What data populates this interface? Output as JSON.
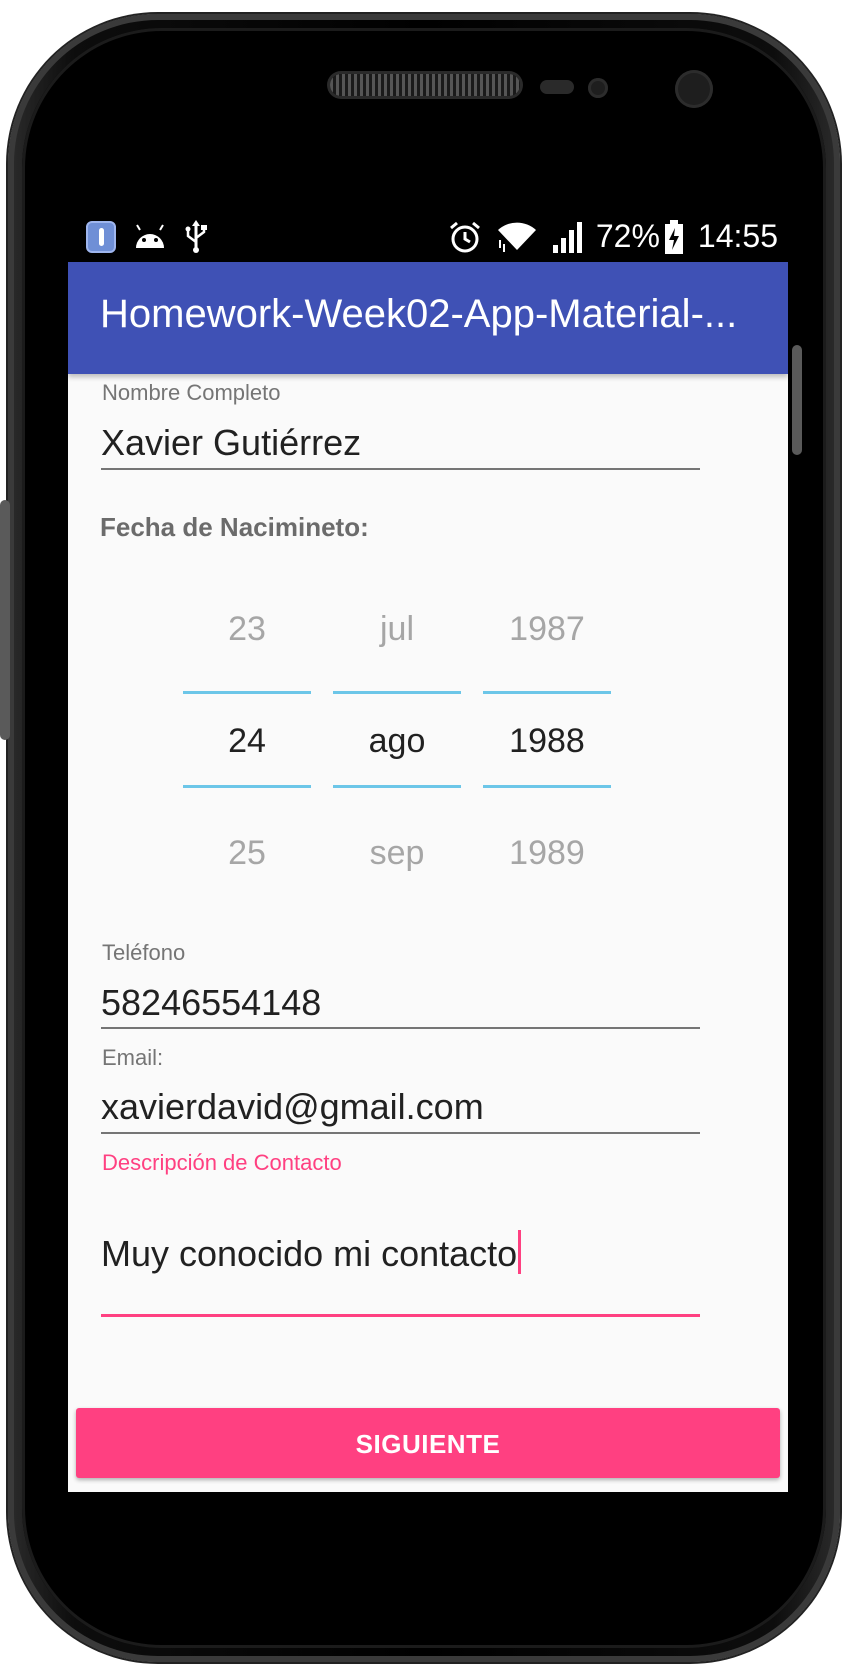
{
  "statusbar": {
    "battery": "72%",
    "time": "14:55",
    "left_icons": [
      "thermometer-app-icon",
      "android-icon",
      "usb-icon"
    ],
    "right_icons": [
      "alarm-icon",
      "wifi-icon",
      "signal-icon",
      "battery-charging-icon"
    ]
  },
  "appbar": {
    "title": "Homework-Week02-App-Material-..."
  },
  "form": {
    "name": {
      "label": "Nombre Completo",
      "value": "Xavier Gutiérrez"
    },
    "birthdate_title": "Fecha de Nacimineto:",
    "picker": {
      "day": {
        "prev": "23",
        "current": "24",
        "next": "25"
      },
      "month": {
        "prev": "jul",
        "current": "ago",
        "next": "sep"
      },
      "year": {
        "prev": "1987",
        "current": "1988",
        "next": "1989"
      }
    },
    "phone": {
      "label": "Teléfono",
      "value": "58246554148"
    },
    "email": {
      "label": "Email:",
      "value": "xavierdavid@gmail.com"
    },
    "description": {
      "label": "Descripción de Contacto",
      "value": "Muy conocido mi contacto"
    },
    "next_button": "SIGUIENTE"
  },
  "colors": {
    "primary": "#3f51b5",
    "accent": "#ff4081",
    "picker_divider": "#6cc6e8",
    "background": "#fafafa"
  }
}
